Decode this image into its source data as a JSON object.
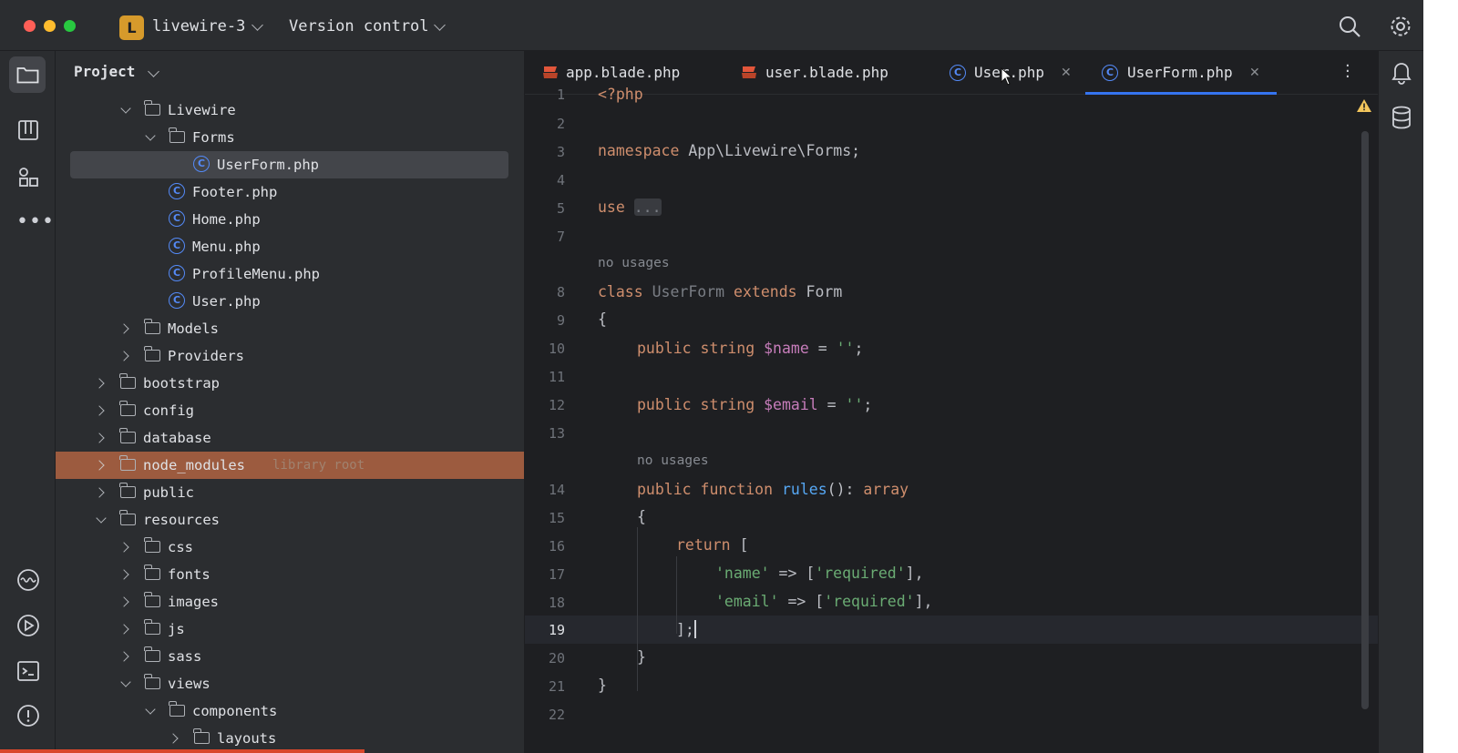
{
  "titlebar": {
    "project_initial": "L",
    "project_name": "livewire-3",
    "vcs_label": "Version control"
  },
  "project_panel": {
    "title": "Project",
    "tree": [
      {
        "label": "Livewire",
        "type": "folder",
        "expanded": true,
        "depth": 2
      },
      {
        "label": "Forms",
        "type": "folder",
        "expanded": true,
        "depth": 3
      },
      {
        "label": "UserForm.php",
        "type": "class-file",
        "depth": 4,
        "selected": true
      },
      {
        "label": "Footer.php",
        "type": "class-file",
        "depth": 3
      },
      {
        "label": "Home.php",
        "type": "class-file",
        "depth": 3
      },
      {
        "label": "Menu.php",
        "type": "class-file",
        "depth": 3
      },
      {
        "label": "ProfileMenu.php",
        "type": "class-file",
        "depth": 3
      },
      {
        "label": "User.php",
        "type": "class-file",
        "depth": 3
      },
      {
        "label": "Models",
        "type": "folder",
        "expanded": false,
        "depth": 2
      },
      {
        "label": "Providers",
        "type": "folder",
        "expanded": false,
        "depth": 2
      },
      {
        "label": "bootstrap",
        "type": "folder",
        "expanded": false,
        "depth": 1
      },
      {
        "label": "config",
        "type": "folder",
        "expanded": false,
        "depth": 1
      },
      {
        "label": "database",
        "type": "folder",
        "expanded": false,
        "depth": 1
      },
      {
        "label": "node_modules",
        "type": "folder",
        "expanded": false,
        "depth": 1,
        "hint": "library root",
        "highlighted": true
      },
      {
        "label": "public",
        "type": "folder",
        "expanded": false,
        "depth": 1
      },
      {
        "label": "resources",
        "type": "folder",
        "expanded": true,
        "depth": 1
      },
      {
        "label": "css",
        "type": "folder",
        "expanded": false,
        "depth": 2
      },
      {
        "label": "fonts",
        "type": "folder",
        "expanded": false,
        "depth": 2
      },
      {
        "label": "images",
        "type": "folder",
        "expanded": false,
        "depth": 2
      },
      {
        "label": "js",
        "type": "folder",
        "expanded": false,
        "depth": 2
      },
      {
        "label": "sass",
        "type": "folder",
        "expanded": false,
        "depth": 2
      },
      {
        "label": "views",
        "type": "folder",
        "expanded": true,
        "depth": 2
      },
      {
        "label": "components",
        "type": "folder",
        "expanded": true,
        "depth": 3
      },
      {
        "label": "layouts",
        "type": "folder",
        "expanded": false,
        "depth": 4
      }
    ]
  },
  "tabs": [
    {
      "label": "app.blade.php",
      "icon": "blade-icon",
      "closable": false
    },
    {
      "label": "user.blade.php",
      "icon": "blade-icon",
      "closable": false
    },
    {
      "label": "User.php",
      "icon": "class-icon",
      "closable": true
    },
    {
      "label": "UserForm.php",
      "icon": "class-icon",
      "closable": true,
      "active": true
    }
  ],
  "tab_close_glyph": "✕",
  "code": {
    "line_numbers": [
      "1",
      "2",
      "3",
      "4",
      "5",
      "7",
      "8",
      "9",
      "10",
      "11",
      "12",
      "13",
      "14",
      "15",
      "16",
      "17",
      "18",
      "19",
      "20",
      "21",
      "22"
    ],
    "line1": "<?php",
    "namespace_kw": "namespace",
    "namespace_val": "App\\Livewire\\Forms;",
    "use_kw": "use",
    "use_fold": "...",
    "usage_hint_1": "no usages",
    "class_kw": "class",
    "class_name": "UserForm",
    "extends_kw": "extends",
    "parent_class": "Form",
    "open_brace": "{",
    "public_kw": "public",
    "string_kw": "string",
    "var_name": "$name",
    "var_email": "$email",
    "assign": "=",
    "empty_str": "''",
    "semicolon": ";",
    "usage_hint_2": "no usages",
    "function_kw": "function",
    "fn_name": "rules",
    "fn_sig": "():",
    "array_kw": "array",
    "return_kw": "return",
    "open_bracket": "[",
    "key_name": "'name'",
    "key_email": "'email'",
    "arrow": "=>",
    "val_open": "[",
    "required_str": "'required'",
    "val_close": "],",
    "close_arr": "];",
    "close_brace": "}"
  },
  "colors": {
    "accent": "#3574f0",
    "keyword": "#cf8e6d",
    "string": "#6aab73",
    "variable": "#c77dbb",
    "function": "#56a8f5",
    "highlight_row": "#9c5b3f"
  }
}
